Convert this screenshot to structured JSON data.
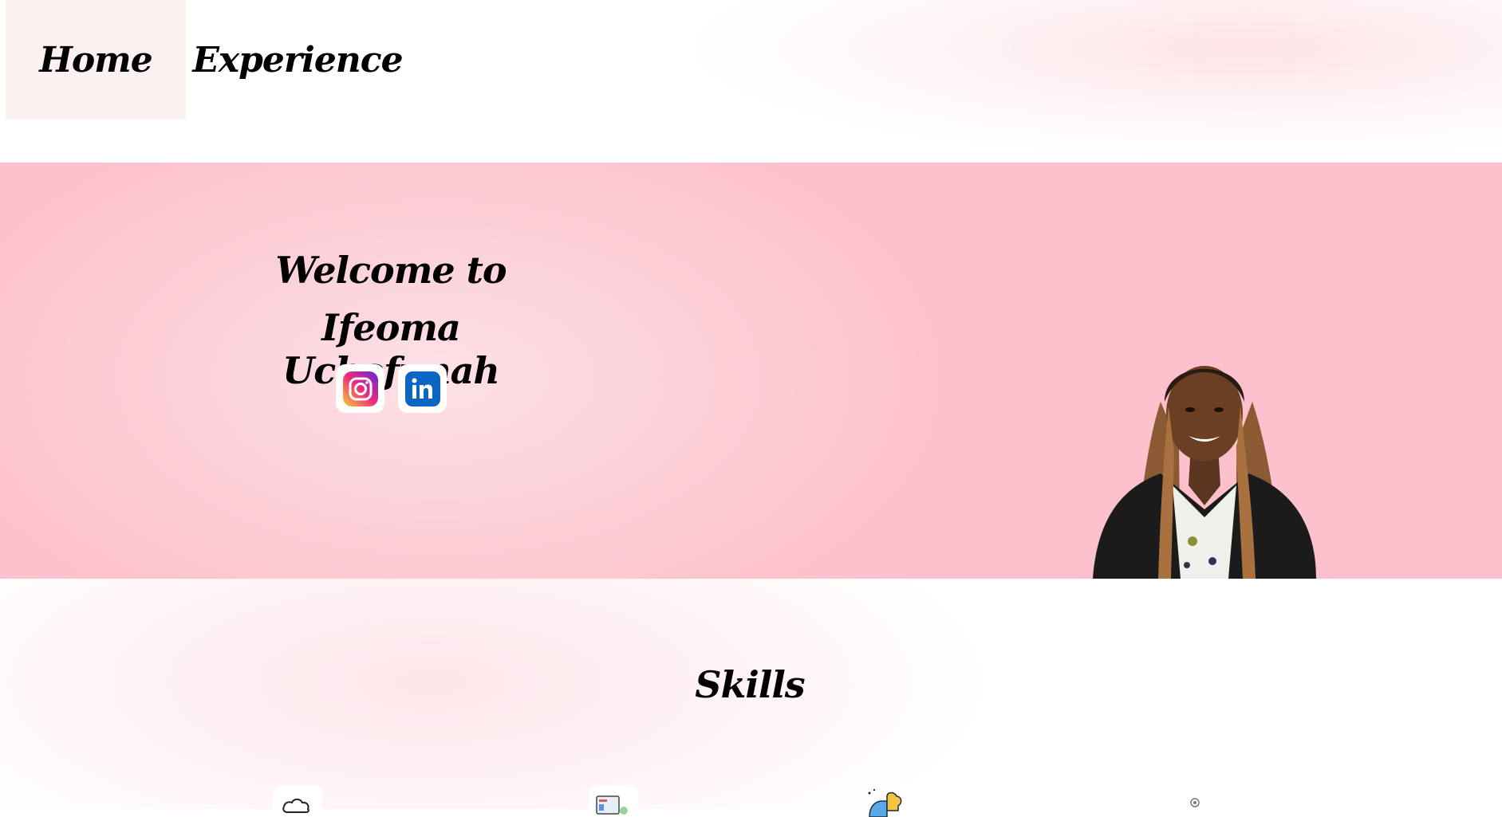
{
  "nav": {
    "home_label": "Home",
    "experience_label": "Experience"
  },
  "hero": {
    "title_line1": "Welcome to",
    "title_line2": "Ifeoma Uchefunah"
  },
  "social": [
    "instagram-icon",
    "linkedin-icon"
  ],
  "skills": {
    "title": "Skills",
    "icons": [
      "cloud-icon",
      "dashboard-icon",
      "puzzle-head-icon",
      "gear-icon"
    ]
  },
  "colors": {
    "hero_bg": "#fcc1cc",
    "accent_pink": "#fde3e6",
    "instagram_gradient": [
      "#f9ce34",
      "#ee2a7b",
      "#6228d7"
    ],
    "linkedin_blue": "#0a66c2"
  }
}
